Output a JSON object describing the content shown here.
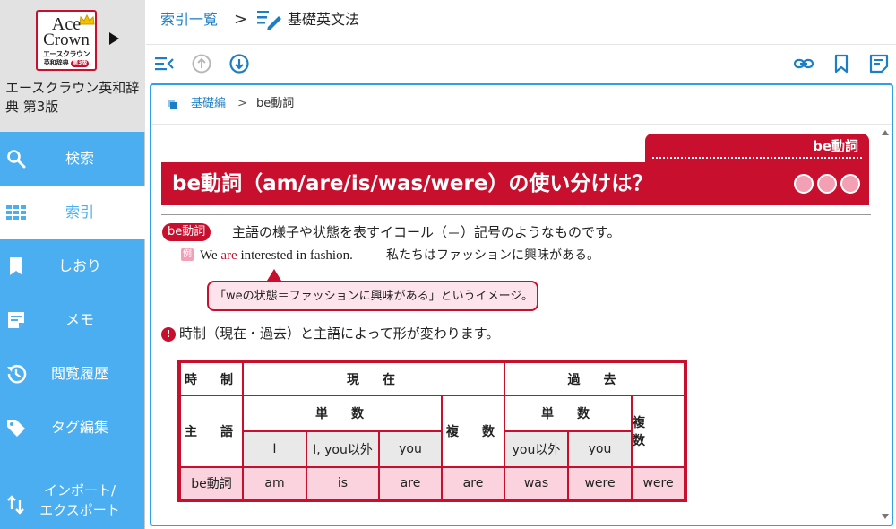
{
  "dictionary": {
    "logo": {
      "line1": "Ace",
      "line2": "Crown",
      "line3": "エースクラウン",
      "line4": "英和辞典",
      "edition_badge": "第3版"
    },
    "title": "エースクラウン英和辞典 第3版"
  },
  "sidebar": {
    "items": [
      {
        "label": "検索",
        "icon": "search-icon"
      },
      {
        "label": "索引",
        "icon": "grid-icon",
        "active": true
      },
      {
        "label": "しおり",
        "icon": "bookmark-icon"
      },
      {
        "label": "メモ",
        "icon": "memo-icon"
      },
      {
        "label": "閲覧履歴",
        "icon": "history-icon"
      },
      {
        "label": "タグ編集",
        "icon": "tag-icon"
      },
      {
        "label": "インポート/\nエクスポート",
        "icon": "import-export-icon"
      }
    ]
  },
  "header": {
    "breadcrumb_root": "索引一覧",
    "breadcrumb_sep": ">",
    "breadcrumb_current": "基礎英文法"
  },
  "content": {
    "breadcrumb_link": "基礎編",
    "breadcrumb_sep": ">",
    "breadcrumb_current": "be動詞",
    "tag": "be動詞",
    "title": "be動詞（am/are/is/was/were）の使い分けは？",
    "badge": "be動詞",
    "description": "主語の様子や状態を表すイコール（＝）記号のようなものです。",
    "example_mark": "例",
    "example_en_1": "We",
    "example_en_hl": "are",
    "example_en_2": "interested in fashion.",
    "example_ja": "私たちはファッションに興味がある。",
    "callout": "「weの状態＝ファッションに興味がある」というイメージ。",
    "note_mark": "!",
    "note": "時制（現在・過去）と主語によって形が変わります。",
    "colors": {
      "accent": "#c8102e",
      "link": "#1c7fc5",
      "sidebar": "#4aaef0"
    }
  },
  "table": {
    "tense_label": "時　制",
    "present": "現　在",
    "past": "過　去",
    "subject_label": "主　語",
    "singular": "単　数",
    "plural": "複　数",
    "present_subjects": [
      "I",
      "I, you以外",
      "you"
    ],
    "past_subjects": [
      "you以外",
      "you"
    ],
    "row_label": "be動詞",
    "present_forms": [
      "am",
      "is",
      "are",
      "are"
    ],
    "past_forms": [
      "was",
      "were",
      "were"
    ]
  }
}
